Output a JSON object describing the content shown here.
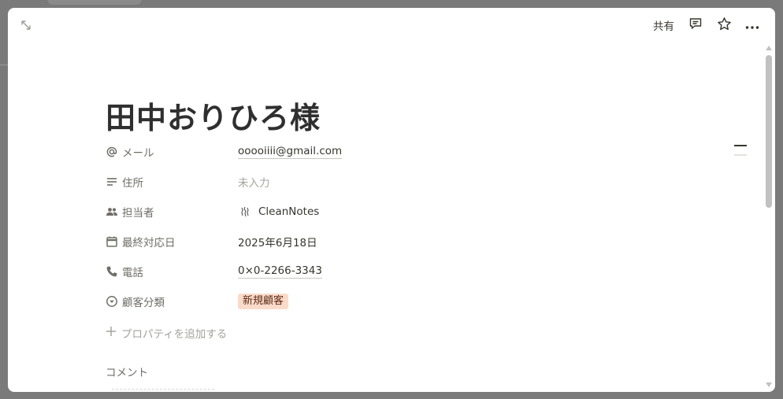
{
  "page": {
    "title": "田中おりひろ様"
  },
  "topbar": {
    "share_label": "共有",
    "icons": [
      "expand-icon",
      "comment-icon",
      "star-icon",
      "more-icon"
    ]
  },
  "properties": [
    {
      "label": "メール",
      "icon": "at-icon",
      "value": "ooooiiii@gmail.com"
    },
    {
      "label": "住所",
      "icon": "text-lines-icon",
      "value": "未入力"
    },
    {
      "label": "担当者",
      "icon": "people-icon",
      "value": "CleanNotes"
    },
    {
      "label": "最終対応日",
      "icon": "calendar-icon",
      "value": "2025年6月18日"
    },
    {
      "label": "電話",
      "icon": "phone-icon",
      "value": "0×0-2266-3343"
    },
    {
      "label": "顧客分類",
      "icon": "select-icon",
      "value": "新規顧客",
      "tag_color": "#fadbcb"
    }
  ],
  "add_property_label": "プロパティを追加する",
  "comments": {
    "heading": "コメント"
  }
}
